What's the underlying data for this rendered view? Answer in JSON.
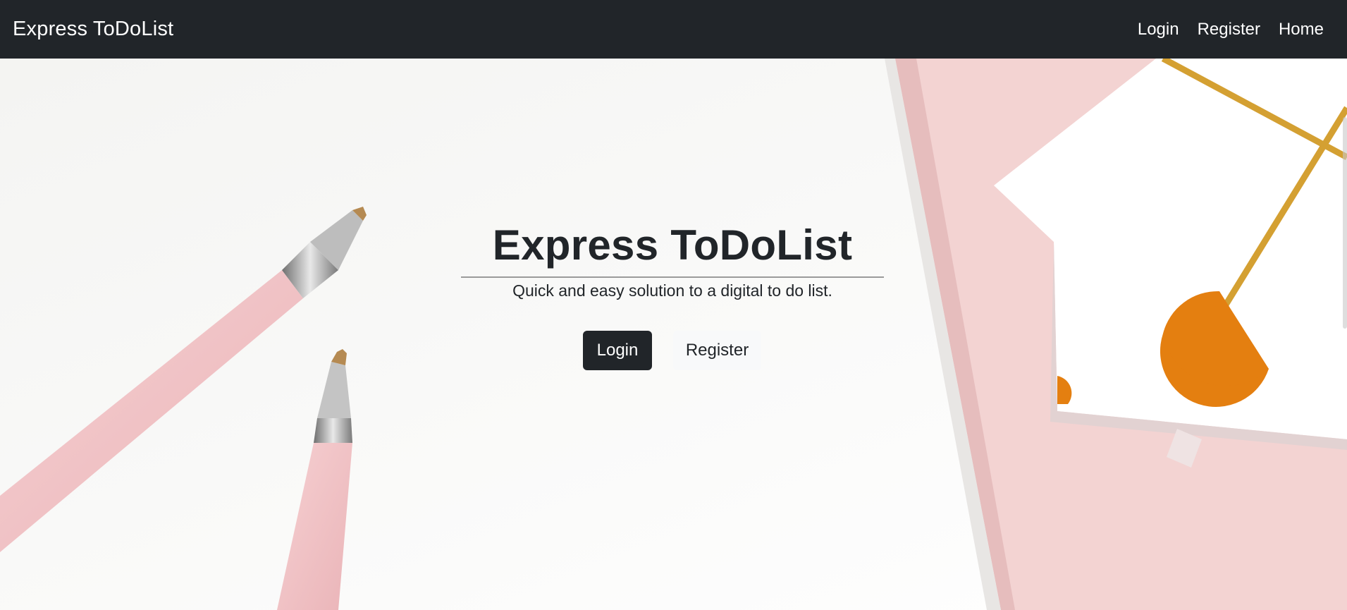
{
  "navbar": {
    "brand": "Express ToDoList",
    "links": [
      "Login",
      "Register",
      "Home"
    ]
  },
  "hero": {
    "title": "Express ToDoList",
    "subtitle": "Quick and easy solution to a digital to do list.",
    "login_label": "Login",
    "register_label": "Register"
  },
  "colors": {
    "navbar_bg": "#212529",
    "pen_pink": "#f2c4c6",
    "notebook_pink": "#f4d2d2",
    "gold_lines": "#d4a032",
    "orange_circle": "#e47f10"
  }
}
